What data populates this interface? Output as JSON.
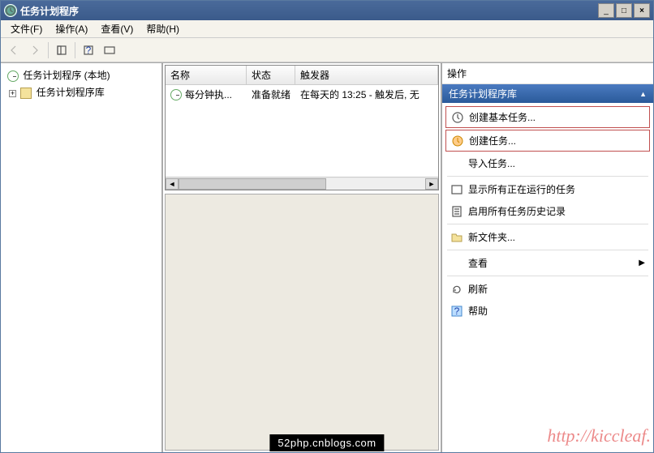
{
  "window": {
    "title": "任务计划程序"
  },
  "menu": {
    "file": "文件(F)",
    "action": "操作(A)",
    "view": "查看(V)",
    "help": "帮助(H)"
  },
  "tree": {
    "root": "任务计划程序 (本地)",
    "library": "任务计划程序库"
  },
  "columns": {
    "name": "名称",
    "status": "状态",
    "trigger": "触发器"
  },
  "tasks": [
    {
      "name": "每分钟执...",
      "status": "准备就绪",
      "trigger": "在每天的 13:25 - 触发后, 无"
    }
  ],
  "actions": {
    "title": "操作",
    "header": "任务计划程序库",
    "items": {
      "create_basic": "创建基本任务...",
      "create_task": "创建任务...",
      "import": "导入任务...",
      "show_running": "显示所有正在运行的任务",
      "enable_history": "启用所有任务历史记录",
      "new_folder": "新文件夹...",
      "view": "查看",
      "refresh": "刷新",
      "help": "帮助"
    }
  },
  "watermark_bottom": "52php.cnblogs.com",
  "watermark_right": "http://kiccleaf."
}
